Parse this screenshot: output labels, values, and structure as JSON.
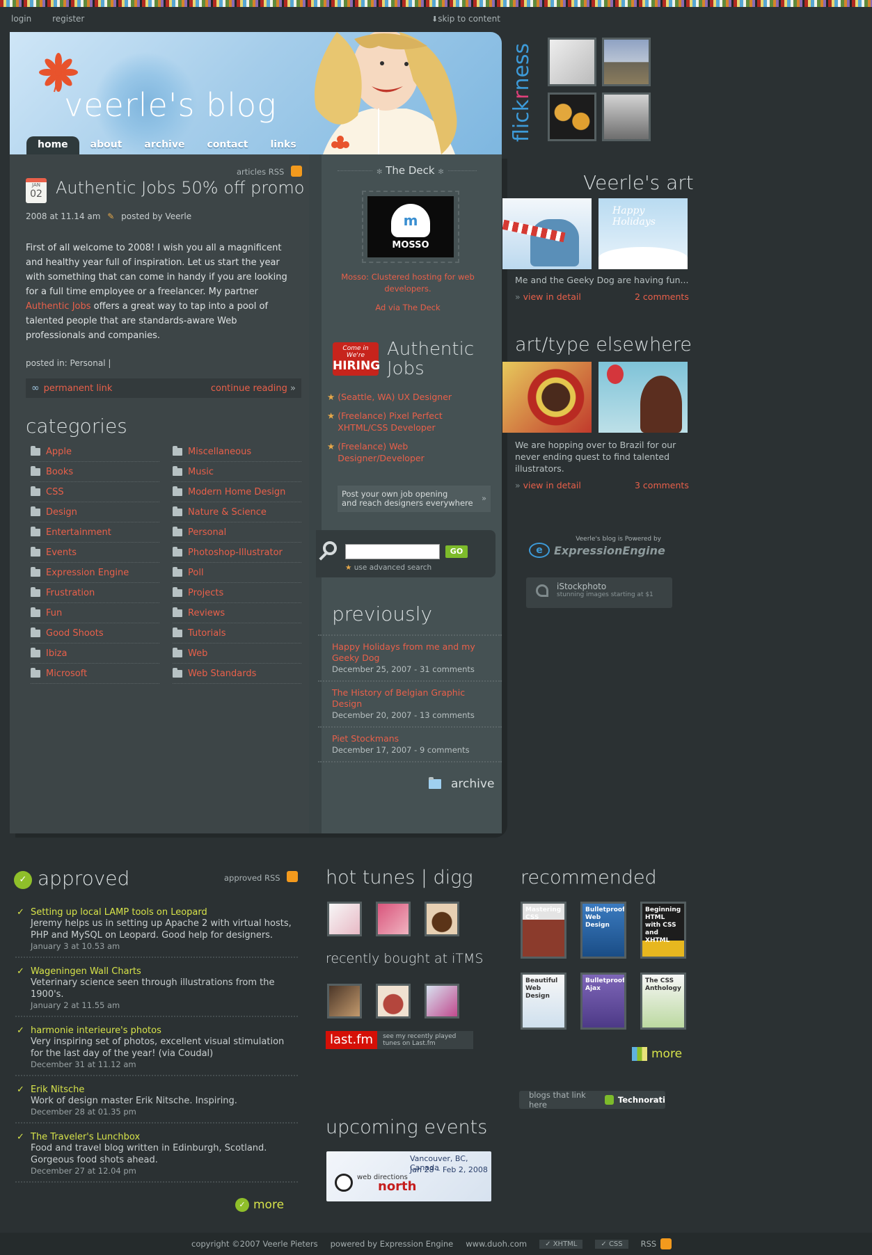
{
  "topnav": {
    "login": "login",
    "register": "register",
    "skip": "skip to content"
  },
  "header": {
    "title": "veerle's blog",
    "tabs": [
      "home",
      "about",
      "archive",
      "contact",
      "links"
    ]
  },
  "post": {
    "rss": "articles RSS",
    "month": "JAN",
    "day": "02",
    "title": "Authentic Jobs 50% off promo",
    "meta": "2008 at 11.14 am",
    "posted_by": "posted by Veerle",
    "body_pre": "First of all welcome to 2008! I wish you all a magnificent and healthy year full of inspiration. Let us start the year with something that can come in handy if you are looking for a full time employee or a freelancer. My partner ",
    "body_link": "Authentic Jobs",
    "body_post": " offers a great way to tap into a pool of talented people that are standards-aware Web professionals and companies.",
    "posted_in": "posted in: Personal |",
    "permalink": "permanent link",
    "continue": "continue reading"
  },
  "categories": {
    "title": "categories",
    "left": [
      "Apple",
      "Books",
      "CSS",
      "Design",
      "Entertainment",
      "Events",
      "Expression Engine",
      "Frustration",
      "Fun",
      "Good Shoots",
      "Ibiza",
      "Microsoft"
    ],
    "right": [
      "Miscellaneous",
      "Music",
      "Modern Home Design",
      "Nature & Science",
      "Personal",
      "Photoshop-Illustrator",
      "Poll",
      "Projects",
      "Reviews",
      "Tutorials",
      "Web",
      "Web Standards"
    ]
  },
  "deck": {
    "title": "The Deck",
    "logo_text": "MOSSO",
    "caption": "Mosso: Clustered hosting for web developers.",
    "ad": "Ad via The Deck"
  },
  "jobs": {
    "badge_top": "Come in We're",
    "badge_bottom": "HIRING",
    "title1": "Authentic",
    "title2": "Jobs",
    "items": [
      "(Seattle, WA) UX Designer",
      "(Freelance) Pixel Perfect XHTML/CSS Developer",
      "(Freelance) Web Designer/Developer"
    ],
    "post1": "Post your own job opening",
    "post2": "and reach designers everywhere"
  },
  "search": {
    "go": "GO",
    "advanced": "use advanced search",
    "value": ""
  },
  "previously": {
    "title": "previously",
    "items": [
      {
        "t": "Happy Holidays from me and my Geeky Dog",
        "d": "December 25, 2007 - 31 comments"
      },
      {
        "t": "The History of Belgian Graphic Design",
        "d": "December 20, 2007 - 13 comments"
      },
      {
        "t": "Piet Stockmans",
        "d": "December 17, 2007 - 9 comments"
      }
    ],
    "archive": "archive"
  },
  "flick": {
    "word_a": "flick",
    "word_b": "r",
    "word_c": "ness"
  },
  "art": {
    "title": "Veerle's art",
    "caption": "Me and the Geeky Dog are having fun...",
    "view": "view in detail",
    "comments": "2 comments",
    "card_text": "Happy Holidays"
  },
  "elsewhere": {
    "title": "art/type elsewhere",
    "caption": "We are hopping over to Brazil for our never ending quest to find talented illustrators.",
    "view": "view in detail",
    "comments": "3 comments"
  },
  "powered": {
    "small": "Veerle's blog is Powered by",
    "brand": "ExpressionEngine"
  },
  "istock": {
    "brand": "iStockphoto",
    "tag": "stunning images starting at $1"
  },
  "approved": {
    "title": "approved",
    "rss": "approved RSS",
    "items": [
      {
        "t": "Setting up local LAMP tools on Leopard",
        "d": "Jeremy helps us in setting up Apache 2 with virtual hosts, PHP and MySQL on Leopard. Good help for designers.",
        "dt": "January 3 at 10.53 am"
      },
      {
        "t": "Wageningen Wall Charts",
        "d": "Veterinary science seen through illustrations from the 1900's.",
        "dt": "January 2 at 11.55 am"
      },
      {
        "t": "harmonie interieure's photos",
        "d": "Very inspiring set of photos, excellent visual stimulation for the last day of the year! (via Coudal)",
        "dt": "December 31 at 11.12 am"
      },
      {
        "t": "Erik Nitsche",
        "d": "Work of design master Erik Nitsche. Inspiring.",
        "dt": "December 28 at 01.35 pm"
      },
      {
        "t": "The Traveler's Lunchbox",
        "d": "Food and travel blog written in Edinburgh, Scotland. Gorgeous food shots ahead.",
        "dt": "December 27 at 12.04 pm"
      }
    ],
    "more": "more"
  },
  "tunes": {
    "title": "hot tunes | digg",
    "bought": "recently bought at iTMS",
    "lastfm": "last.fm",
    "lastfm_text1": "see my recently played",
    "lastfm_text2": "tunes on Last.fm"
  },
  "recommended": {
    "title": "recommended",
    "books": [
      "Mastering CSS",
      "Bulletproof Web Design",
      "Beginning HTML with CSS and XHTML",
      "Beautiful Web Design",
      "Bulletproof Ajax",
      "The CSS Anthology"
    ],
    "more": "more",
    "technorati_pre": "blogs that link here",
    "technorati": "Technorati"
  },
  "events": {
    "title": "upcoming events",
    "place": "Vancouver, BC, Canada",
    "dates": "Jan 28 – Feb 2, 2008",
    "brand1": "web directions",
    "brand2": "north"
  },
  "footer": {
    "copyright": "copyright ©2007 Veerle Pieters",
    "powered": "powered by Expression Engine",
    "site": "www.duoh.com",
    "xhtml": "XHTML",
    "css": "CSS",
    "rss": "RSS"
  }
}
